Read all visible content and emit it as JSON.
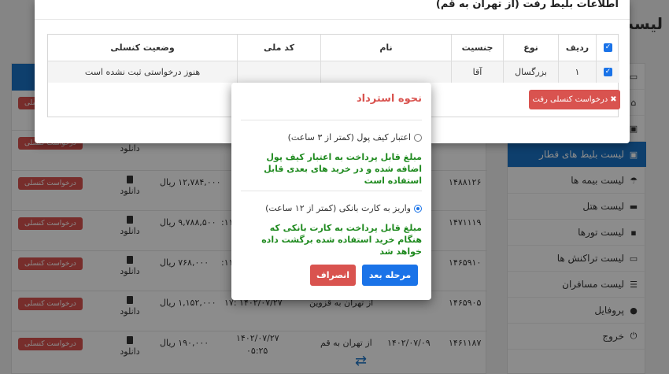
{
  "page": {
    "title": "لیست"
  },
  "sidebar": {
    "items": [
      {
        "label": "لیست بلیط های قطار",
        "icon": "train-icon",
        "active": true
      },
      {
        "label": "لیست بیمه ها",
        "icon": "umbrella-icon"
      },
      {
        "label": "لیست هتل",
        "icon": "bed-icon"
      },
      {
        "label": "لیست تورها",
        "icon": "suitcase-icon"
      },
      {
        "label": "لیست تراکنش ها",
        "icon": "money-icon"
      },
      {
        "label": "لیست مسافران",
        "icon": "list-icon"
      },
      {
        "label": "پروفایل",
        "icon": "user-icon"
      },
      {
        "label": "خروج",
        "icon": "power-icon"
      }
    ]
  },
  "bg_table": {
    "rows": [
      {
        "id": "",
        "price": "",
        "time": "",
        "cancel": "درخواست کنسلی",
        "download": "دانلود"
      },
      {
        "id": "",
        "price": "",
        "time": "",
        "cancel": "درخواست کنسلی",
        "download": "دانلود"
      },
      {
        "id": "۱۴۸۸۱۲۶",
        "price": "۱۲,۷۸۴,۰۰۰ ریال",
        "time": "",
        "cancel": "درخواست کنسلی",
        "download": "دانلود"
      },
      {
        "id": "۱۴۷۱۱۱۹",
        "price": "۹,۷۸۸,۵۰۰ ریال",
        "time": "۱۱:",
        "cancel": "درخواست کنسلی",
        "download": "دانلود"
      },
      {
        "id": "۱۴۶۵۹۱۰",
        "price": "۷۶۸,۰۰۰ ریال",
        "time": "۱۱:",
        "cancel": "درخواست کنسلی",
        "download": "دانلود"
      },
      {
        "id": "۱۴۶۵۹۰۵",
        "price": "۱,۱۵۲,۰۰۰ ریال",
        "time": "۱۴۰۲/۰۷/۲۷ :۱۷",
        "route": "از تهران به قزوین",
        "cancel": "درخواست کنسلی",
        "download": "دانلود"
      },
      {
        "id": "۱۴۶۱۱۸۷",
        "date": "۱۴۰۲/۰۷/۰۹",
        "route": "از تهران به قم",
        "time": "۱۴۰۲/۰۷/۲۷",
        "time2": "۰۵:۲۵",
        "price": "۱۹۰,۰۰۰ ریال",
        "cancel": "درخواست کنسلی",
        "download": "دانلود"
      }
    ]
  },
  "ticket_modal": {
    "title": "اطلاعات بلیط رفت (از تهران به قم)",
    "columns": [
      "ردیف",
      "نوع",
      "جنسیت",
      "نام",
      "کد ملی",
      "وضعیت کنسلی"
    ],
    "row": {
      "index": "۱",
      "type": "بزرگسال",
      "gender": "آقا",
      "name": "",
      "national_id": "",
      "status": "هنوز درخواستی ثبت نشده است"
    },
    "request_cancel_button": "درخواست کنسلی رفت"
  },
  "refund_dialog": {
    "title": "نحوه استرداد",
    "options": [
      {
        "label": "اعتبار کیف پول (کمتر از ۳ ساعت)",
        "selected": false,
        "description": "مبلغ قابل پرداخت به اعتبار کیف پول اضافه شده و در خرید های بعدی قابل استفاده است"
      },
      {
        "label": "واریز به کارت بانکی (کمتر از ۱۲ ساعت)",
        "selected": true,
        "description": "مبلغ قابل پرداخت به کارت بانکی که هنگام خرید استفاده شده برگشت داده خواهد شد"
      }
    ],
    "next_button": "مرحله بعد",
    "cancel_button": "انصراف"
  },
  "colors": {
    "primary": "#1a73e8",
    "danger": "#d9534f",
    "success": "#1f8a1f",
    "sidebar_active": "#1b73c6"
  }
}
